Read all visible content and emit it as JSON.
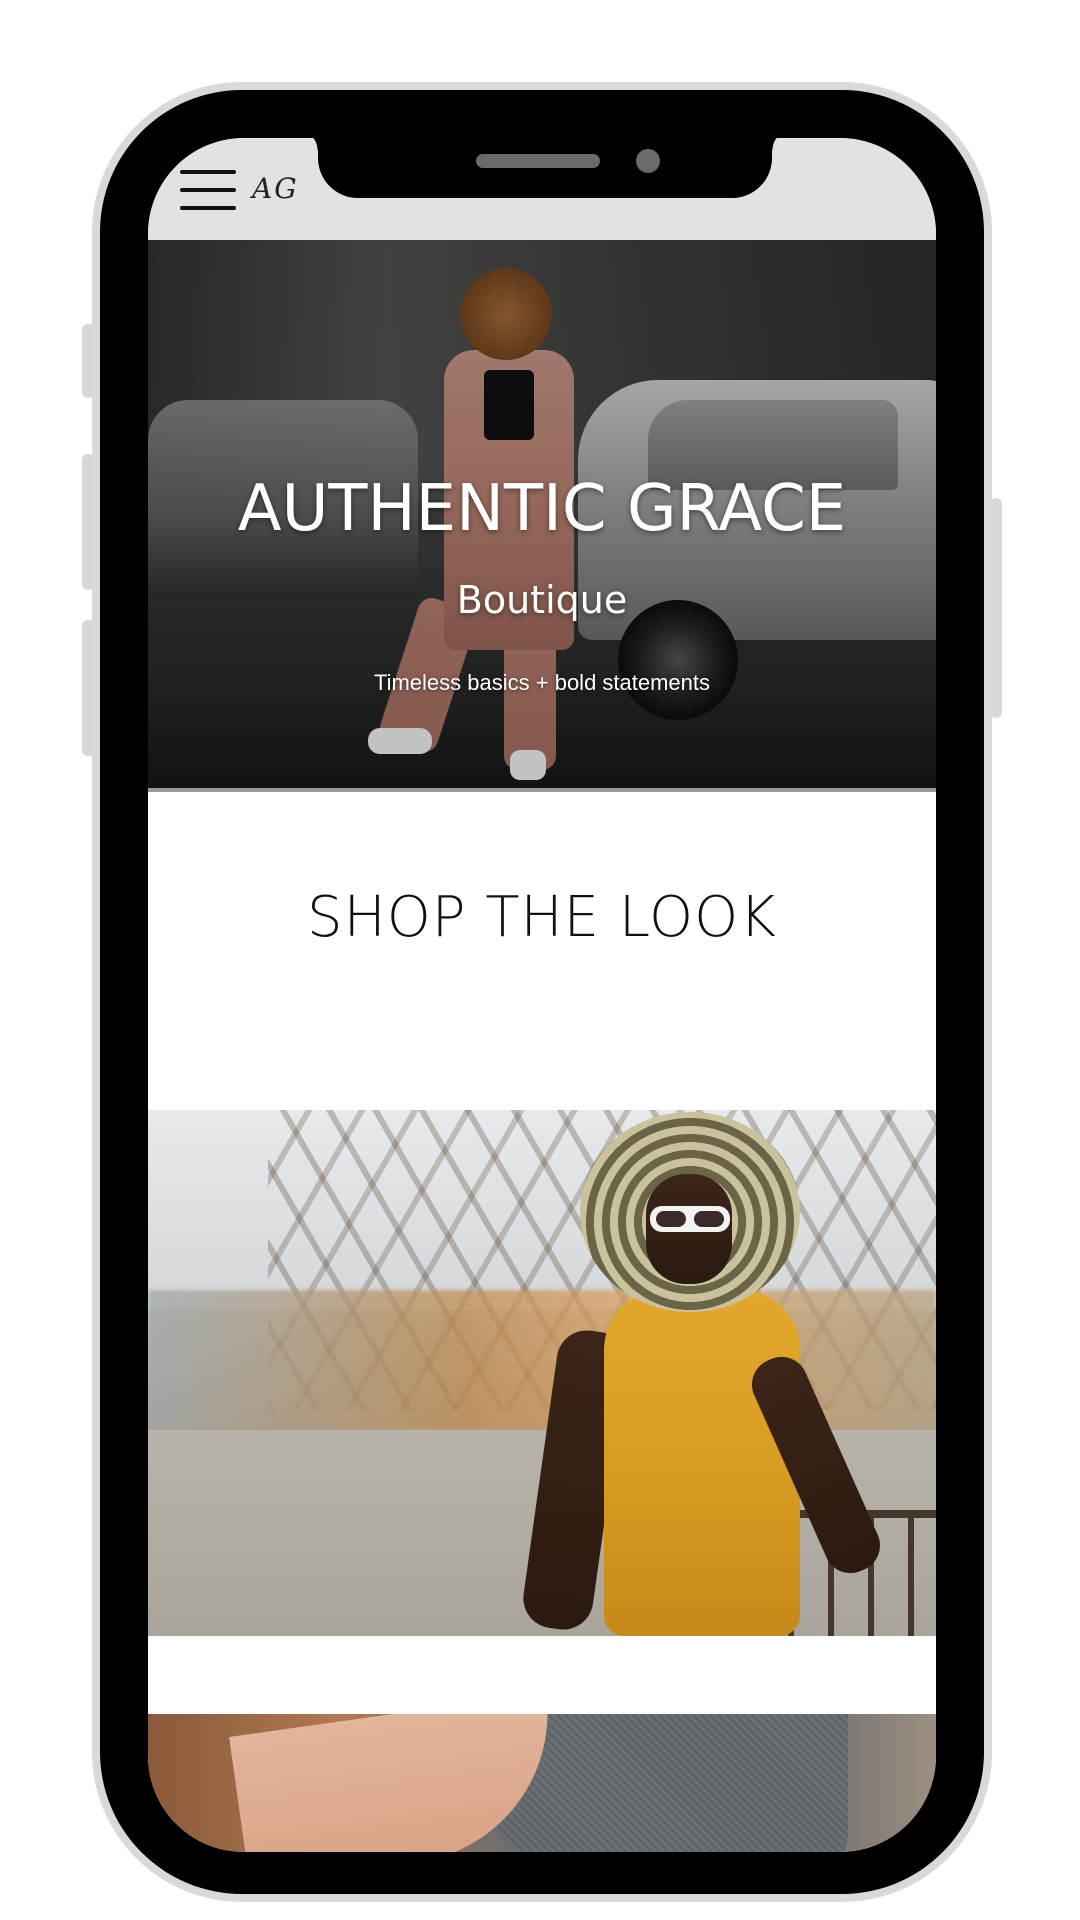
{
  "header": {
    "logo_text": "AG",
    "menu_icon": "hamburger-menu-icon"
  },
  "hero": {
    "title": "AUTHENTIC GRACE",
    "subtitle": "Boutique",
    "tagline": "Timeless basics + bold statements"
  },
  "section": {
    "title": "SHOP THE LOOK"
  },
  "colors": {
    "topbar_bg": "#e2e2e2",
    "phone_frame": "#000000",
    "phone_outer": "#d9d9d9",
    "text_dark": "#111111",
    "hero_text": "#ffffff"
  }
}
